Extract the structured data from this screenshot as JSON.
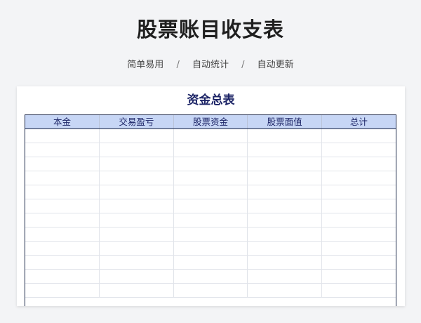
{
  "header": {
    "title": "股票账目收支表",
    "features": [
      "简单易用",
      "自动统计",
      "自动更新"
    ],
    "separator": "/"
  },
  "sheet": {
    "title": "资金总表",
    "columns": [
      "本金",
      "交易盈亏",
      "股票资金",
      "股票面值",
      "总计"
    ],
    "rows": [
      [
        "",
        "",
        "",
        "",
        ""
      ],
      [
        "",
        "",
        "",
        "",
        ""
      ],
      [
        "",
        "",
        "",
        "",
        ""
      ],
      [
        "",
        "",
        "",
        "",
        ""
      ],
      [
        "",
        "",
        "",
        "",
        ""
      ],
      [
        "",
        "",
        "",
        "",
        ""
      ],
      [
        "",
        "",
        "",
        "",
        ""
      ],
      [
        "",
        "",
        "",
        "",
        ""
      ],
      [
        "",
        "",
        "",
        "",
        ""
      ],
      [
        "",
        "",
        "",
        "",
        ""
      ],
      [
        "",
        "",
        "",
        "",
        ""
      ],
      [
        "",
        "",
        "",
        "",
        ""
      ]
    ]
  },
  "colors": {
    "header_fill": "#c7d6f5",
    "title_color": "#1c2466",
    "border": "#1e2a4a"
  }
}
